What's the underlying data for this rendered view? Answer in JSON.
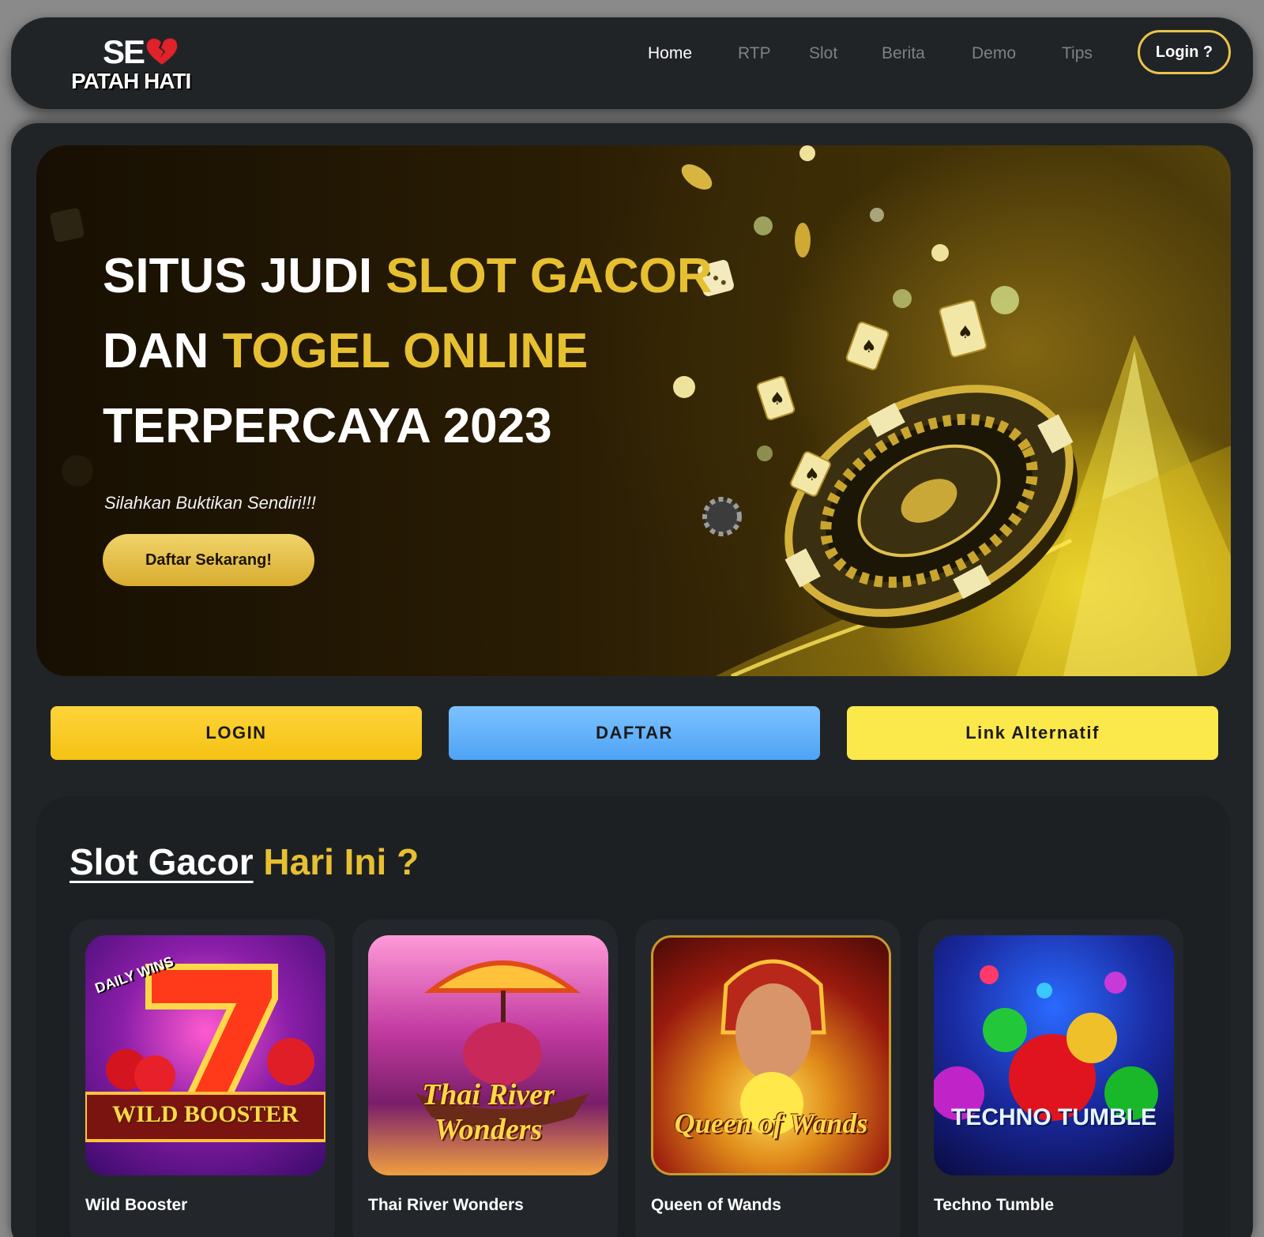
{
  "nav": {
    "logo_line1": "SE",
    "logo_line2": "PATAH HATI",
    "items": [
      {
        "label": "Home",
        "active": true
      },
      {
        "label": "RTP",
        "active": false
      },
      {
        "label": "Slot",
        "active": false
      },
      {
        "label": "Berita",
        "active": false
      },
      {
        "label": "Demo",
        "active": false
      },
      {
        "label": "Tips",
        "active": false
      }
    ],
    "login_label": "Login ?"
  },
  "hero": {
    "title_line1_white": "SITUS JUDI ",
    "title_line1_gold": "SLOT GACOR",
    "title_line2_white": "DAN ",
    "title_line2_gold": "TOGEL ONLINE",
    "title_line3": "TERPERCAYA 2023",
    "subtitle": "Silahkan Buktikan Sendiri!!!",
    "cta_label": "Daftar Sekarang!"
  },
  "actions": {
    "login_label": "LOGIN",
    "daftar_label": "DAFTAR",
    "alt_label": "Link Alternatif"
  },
  "slot_section": {
    "title_underlined": "Slot Gacor",
    "title_gold": " Hari Ini ?",
    "games": [
      {
        "name": "Wild Booster",
        "thumb_text": "WILD BOOSTER",
        "badge": "DAILY WINS"
      },
      {
        "name": "Thai River Wonders",
        "thumb_text": "Thai River Wonders"
      },
      {
        "name": "Queen of Wands",
        "thumb_text": "Queen of Wands"
      },
      {
        "name": "Techno Tumble",
        "thumb_text": "TECHNO TUMBLE"
      }
    ]
  },
  "colors": {
    "accent_gold": "#e7c031",
    "login_yellow": "#f5c214",
    "daftar_blue": "#4ea3f5",
    "alt_yellow": "#fbe84a",
    "panel_dark": "#212427"
  }
}
